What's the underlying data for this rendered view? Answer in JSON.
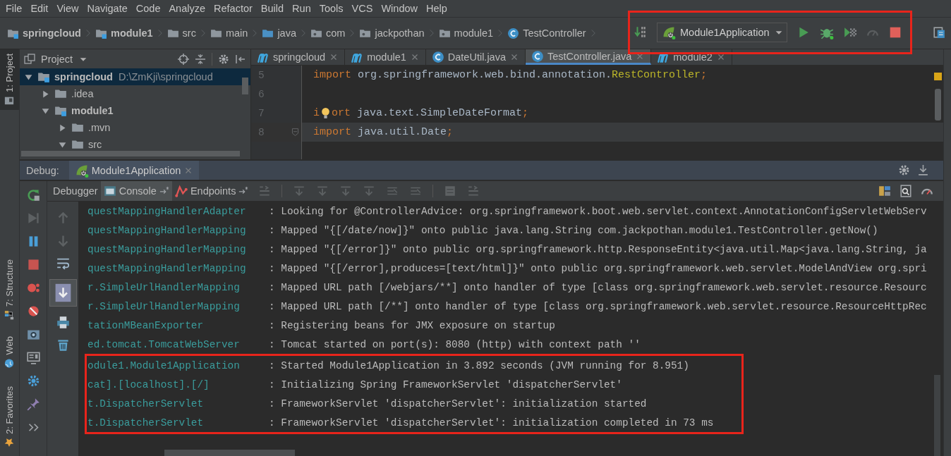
{
  "menu": [
    "File",
    "Edit",
    "View",
    "Navigate",
    "Code",
    "Analyze",
    "Refactor",
    "Build",
    "Run",
    "Tools",
    "VCS",
    "Window",
    "Help"
  ],
  "breadcrumbs": [
    {
      "label": "springcloud",
      "kind": "module"
    },
    {
      "label": "module1",
      "kind": "module"
    },
    {
      "label": "src",
      "kind": "folder"
    },
    {
      "label": "main",
      "kind": "folder"
    },
    {
      "label": "java",
      "kind": "source"
    },
    {
      "label": "com",
      "kind": "package"
    },
    {
      "label": "jackpothan",
      "kind": "package"
    },
    {
      "label": "module1",
      "kind": "package"
    },
    {
      "label": "TestController",
      "kind": "class"
    }
  ],
  "run_toolbar": {
    "configuration": "Module1Application",
    "highlighted": true
  },
  "tool_windows_left": [
    {
      "label": "1: Project",
      "selected": true,
      "kind": "project"
    },
    {
      "label": "7: Structure",
      "selected": false,
      "kind": "structure"
    },
    {
      "label": "Web",
      "selected": false,
      "kind": "web"
    },
    {
      "label": "2: Favorites",
      "selected": false,
      "kind": "favorites"
    }
  ],
  "project_panel": {
    "title": "Project",
    "tree": [
      {
        "label": "springcloud",
        "kind": "module",
        "path": "D:\\ZmKji\\springcloud",
        "expanded": true,
        "selected": true,
        "children": [
          {
            "label": ".idea",
            "kind": "folder",
            "expanded": false,
            "selected": false
          },
          {
            "label": "module1",
            "kind": "module",
            "expanded": true,
            "selected": false,
            "children": [
              {
                "label": ".mvn",
                "kind": "folder",
                "expanded": false,
                "selected": false
              },
              {
                "label": "src",
                "kind": "folder",
                "expanded": true,
                "selected": false
              }
            ]
          }
        ]
      }
    ]
  },
  "editor": {
    "tabs": [
      {
        "label": "springcloud",
        "kind": "module",
        "selected": false
      },
      {
        "label": "module1",
        "kind": "module",
        "selected": false
      },
      {
        "label": "DateUtil.java",
        "kind": "class",
        "selected": false
      },
      {
        "label": "TestController.java",
        "kind": "class",
        "selected": true
      },
      {
        "label": "module2",
        "kind": "module",
        "selected": false
      }
    ],
    "lines": [
      {
        "number": "5",
        "current": false,
        "tokens": [
          {
            "text": "import ",
            "kind": "keyword"
          },
          {
            "text": "org.springframework.web.bind.annotation.",
            "kind": "plain"
          },
          {
            "text": "RestController",
            "kind": "annotation"
          },
          {
            "text": ";",
            "kind": "keyword"
          }
        ]
      },
      {
        "number": "6",
        "current": false
      },
      {
        "number": "7",
        "current": false,
        "tokens": [
          {
            "text": "i",
            "kind": "keyword"
          },
          {
            "kind": "bulb"
          },
          {
            "text": "ort ",
            "kind": "keyword"
          },
          {
            "text": "java.text.SimpleDateFormat",
            "kind": "plain"
          },
          {
            "text": ";",
            "kind": "keyword"
          }
        ]
      },
      {
        "number": "8",
        "current": true,
        "fold": true,
        "tokens": [
          {
            "text": "import ",
            "kind": "keyword"
          },
          {
            "text": "java.util.Date",
            "kind": "plain"
          },
          {
            "text": ";",
            "kind": "keyword"
          }
        ]
      }
    ]
  },
  "debug": {
    "label": "Debug:",
    "session": "Module1Application",
    "tabs": [
      {
        "label": "Debugger",
        "selected": false,
        "kind": "debugger"
      },
      {
        "label": "Console",
        "selected": true,
        "kind": "console"
      },
      {
        "label": "Endpoints",
        "selected": false,
        "kind": "endpoints"
      }
    ],
    "console": [
      {
        "logger": "questMappingHandlerAdapter",
        "message": ": Looking for @ControllerAdvice: org.springframework.boot.web.servlet.context.AnnotationConfigServletWebServ",
        "highlighted": false
      },
      {
        "logger": "questMappingHandlerMapping",
        "message": ": Mapped \"{[/date/now]}\" onto public java.lang.String com.jackpothan.module1.TestController.getNow()",
        "highlighted": false
      },
      {
        "logger": "questMappingHandlerMapping",
        "message": ": Mapped \"{[/error]}\" onto public org.springframework.http.ResponseEntity<java.util.Map<java.lang.String, ja",
        "highlighted": false
      },
      {
        "logger": "questMappingHandlerMapping",
        "message": ": Mapped \"{[/error],produces=[text/html]}\" onto public org.springframework.web.servlet.ModelAndView org.spri",
        "highlighted": false
      },
      {
        "logger": "r.SimpleUrlHandlerMapping",
        "message": ": Mapped URL path [/webjars/**] onto handler of type [class org.springframework.web.servlet.resource.Resourc",
        "highlighted": false
      },
      {
        "logger": "r.SimpleUrlHandlerMapping",
        "message": ": Mapped URL path [/**] onto handler of type [class org.springframework.web.servlet.resource.ResourceHttpRec",
        "highlighted": false
      },
      {
        "logger": "tationMBeanExporter",
        "message": ": Registering beans for JMX exposure on startup",
        "highlighted": false
      },
      {
        "logger": "ed.tomcat.TomcatWebServer",
        "message": ": Tomcat started on port(s): 8080 (http) with context path ''",
        "highlighted": false
      },
      {
        "logger": "odule1.Module1Application",
        "message": ": Started Module1Application in 3.892 seconds (JVM running for 8.951)",
        "highlighted": true
      },
      {
        "logger": "cat].[localhost].[/]",
        "message": ": Initializing Spring FrameworkServlet 'dispatcherServlet'",
        "highlighted": true
      },
      {
        "logger": "t.DispatcherServlet",
        "message": ": FrameworkServlet 'dispatcherServlet': initialization started",
        "highlighted": true
      },
      {
        "logger": "t.DispatcherServlet",
        "message": ": FrameworkServlet 'dispatcherServlet': initialization completed in 73 ms",
        "highlighted": true
      }
    ]
  }
}
